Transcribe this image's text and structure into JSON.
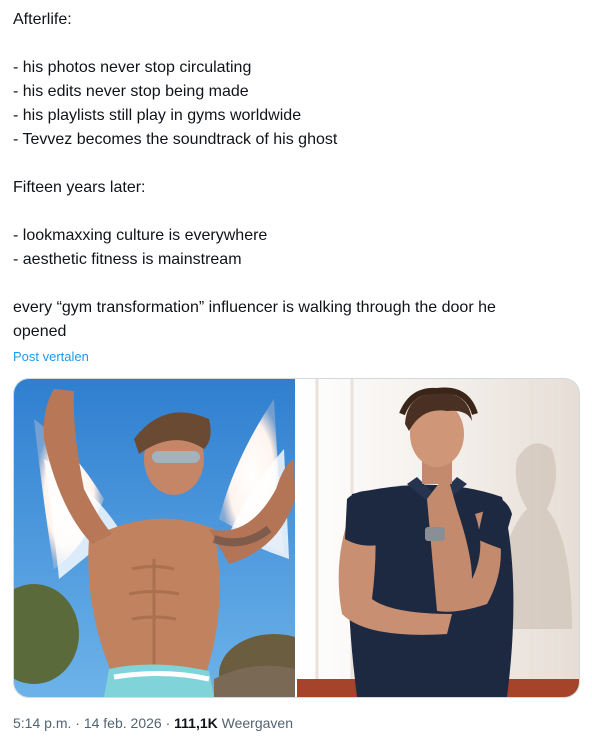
{
  "tweet": {
    "lines": [
      "Afterlife:",
      "",
      "- his photos never stop circulating",
      "- his edits never stop being made",
      "- his playlists still play in gyms worldwide",
      "- Tevvez becomes the soundtrack of his ghost",
      "",
      "Fifteen years later:",
      "",
      "- lookmaxxing culture is everywhere",
      "- aesthetic fitness is mainstream",
      "",
      "every “gym transformation” influencer is walking through the door he",
      "opened"
    ],
    "translate_label": "Post vertalen"
  },
  "media": {
    "images": [
      {
        "name": "photo-shirtless-man-with-wings",
        "sky_color": "#3f8fd6",
        "wing_color": "#ffffff"
      },
      {
        "name": "photo-man-in-navy-polo",
        "shirt_color": "#1c2940",
        "background_color": "#f3eeea"
      }
    ]
  },
  "meta": {
    "time": "5:14 p.m.",
    "separator_1": "·",
    "date": "14 feb. 2026",
    "separator_2": "·",
    "views_count": "111,1K",
    "views_label": "Weergaven"
  }
}
